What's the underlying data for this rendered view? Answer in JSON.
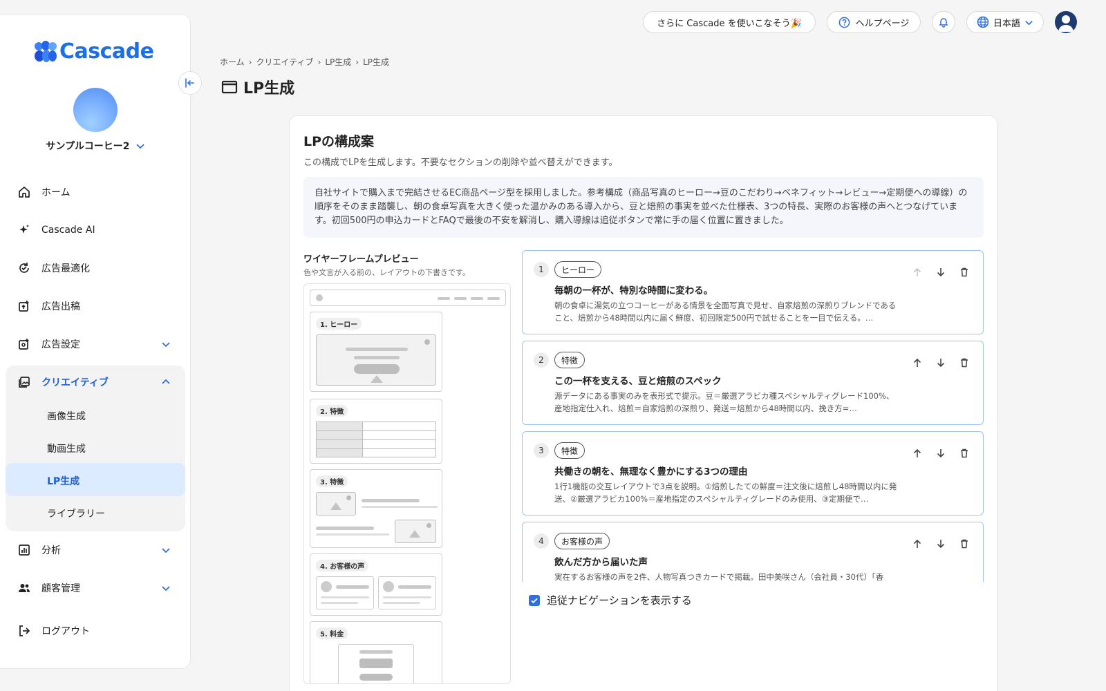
{
  "brand": {
    "name": "Cascade"
  },
  "account": {
    "name": "サンプルコーヒー2"
  },
  "nav": [
    {
      "label": "ホーム",
      "icon": "home-icon"
    },
    {
      "label": "Cascade AI",
      "icon": "sparkle-icon"
    },
    {
      "label": "広告最適化",
      "icon": "optimize-icon"
    },
    {
      "label": "広告出稿",
      "icon": "publish-icon"
    },
    {
      "label": "広告設定",
      "icon": "settings-icon"
    },
    {
      "label": "クリエイティブ",
      "icon": "image-icon"
    },
    {
      "label": "分析",
      "icon": "chart-icon"
    },
    {
      "label": "顧客管理",
      "icon": "people-icon"
    },
    {
      "label": "ログアウト",
      "icon": "logout-icon"
    }
  ],
  "creative_sub": [
    "画像生成",
    "動画生成",
    "LP生成",
    "ライブラリー"
  ],
  "topbar": {
    "promo": "さらに Cascade を使いこなそう🎉",
    "help": "ヘルプページ",
    "language": "日本語"
  },
  "breadcrumb": [
    "ホーム",
    "クリエイティブ",
    "LP生成",
    "LP生成"
  ],
  "page_title": "LP生成",
  "card": {
    "title": "LPの構成案",
    "subtitle": "この構成でLPを生成します。不要なセクションの削除や並べ替えができます。",
    "summary": "自社サイトで購入まで完結させるEC商品ページ型を採用しました。参考構成（商品写真のヒーロー→豆のこだわり→ベネフィット→レビュー→定期便への導線）の順序をそのまま踏襲し、朝の食卓写真を大きく使った温かみのある導入から、豆と焙煎の事実を並べた仕様表、3つの特長、実際のお客様の声へとつなげています。初回500円の申込カードとFAQで最後の不安を解消し、購入導線は追従ボタンで常に手の届く位置に置きました。"
  },
  "wireframe": {
    "title": "ワイヤーフレームプレビュー",
    "subtitle": "色や文言が入る前の、レイアウトの下書きです。",
    "blocks": [
      "1. ヒーロー",
      "2. 特徴",
      "3. 特徴",
      "4. お客様の声",
      "5. 料金"
    ]
  },
  "sections": [
    {
      "num": "1",
      "tag": "ヒーロー",
      "heading": "毎朝の一杯が、特別な時間に変わる。",
      "desc": "朝の食卓に湯気の立つコーヒーがある情景を全面写真で見せ、自家焙煎の深煎りブレンドであること、焙煎から48時間以内に届く鮮度、初回限定500円で試せることを一目で伝える。…"
    },
    {
      "num": "2",
      "tag": "特徴",
      "heading": "この一杯を支える、豆と焙煎のスペック",
      "desc": "源データにある事実のみを表形式で提示。豆＝厳選アラビカ種スペシャルティグレード100%、産地指定仕入れ、焙煎＝自家焙煎の深煎り、発送＝焙煎から48時間以内、挽き方=…"
    },
    {
      "num": "3",
      "tag": "特徴",
      "heading": "共働きの朝を、無理なく豊かにする3つの理由",
      "desc": "1行1機能の交互レイアウトで3点を説明。①焙煎したての鮮度＝注文後に焙煎し48時間以内に発送、②厳選アラビカ100%＝産地指定のスペシャルティグレードのみ使用、③定期便で…"
    },
    {
      "num": "4",
      "tag": "お客様の声",
      "heading": "飲んだ方から届いた声",
      "desc": "実在するお客様の声を2件、人物写真つきカードで掲載。田中美咲さん（会社員・30代）「香"
    }
  ],
  "follow_nav": {
    "label": "追従ナビゲーションを表示する",
    "checked": true
  },
  "colors": {
    "accent": "#1d6fe8",
    "active_bg": "#dcebff",
    "section_border": "#9ec4f5"
  }
}
